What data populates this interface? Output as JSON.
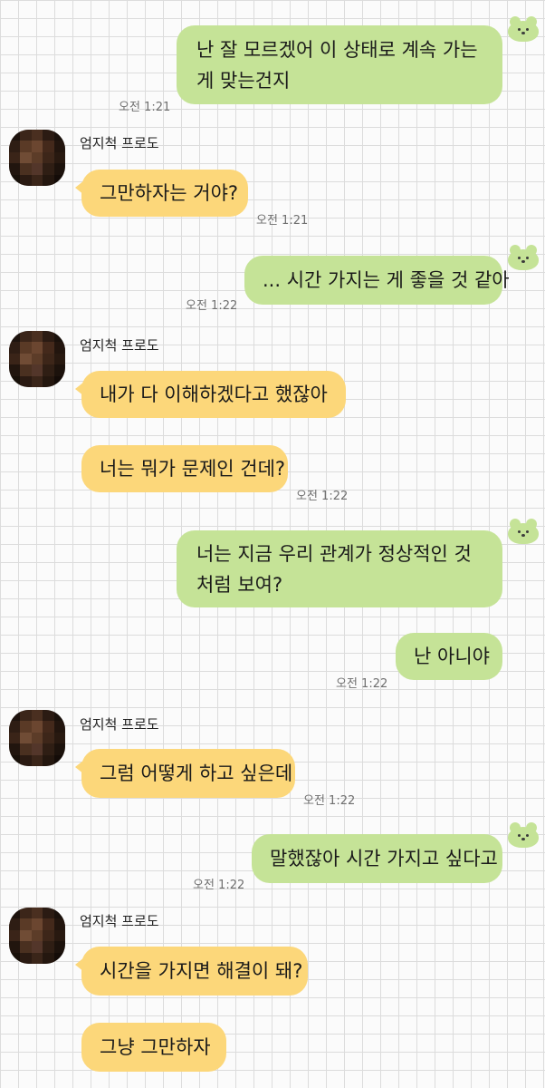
{
  "messages": {
    "m1": {
      "text": "난 잘 모르겠어 이 상태로 계속 가는게 맞는건지",
      "time": "오전 1:21"
    },
    "m2": {
      "sender": "엄지척 프로도",
      "text": "그만하자는 거야?",
      "time": "오전 1:21"
    },
    "m3": {
      "text": "... 시간 가지는 게 좋을 것 같아",
      "time": "오전 1:22"
    },
    "m4": {
      "sender": "엄지척 프로도",
      "text": "내가 다 이해하겠다고 했잖아"
    },
    "m5": {
      "text": "너는 뭐가 문제인 건데?",
      "time": "오전 1:22"
    },
    "m6": {
      "text": "너는 지금 우리 관계가 정상적인 것처럼 보여?"
    },
    "m7": {
      "text": "난 아니야",
      "time": "오전 1:22"
    },
    "m8": {
      "sender": "엄지척 프로도",
      "text": "그럼 어떻게 하고 싶은데",
      "time": "오전 1:22"
    },
    "m9": {
      "text": "말했잖아 시간 가지고 싶다고",
      "time": "오전 1:22"
    },
    "m10": {
      "sender": "엄지척 프로도",
      "text": "시간을 가지면 해결이 돼?"
    },
    "m11": {
      "text": "그냥 그만하자"
    }
  },
  "colors": {
    "outgoing": "#c5e397",
    "incoming": "#fcd77a"
  },
  "icons": {
    "outgoing_badge": "bear-face-icon",
    "avatar": "pixelated-avatar"
  }
}
